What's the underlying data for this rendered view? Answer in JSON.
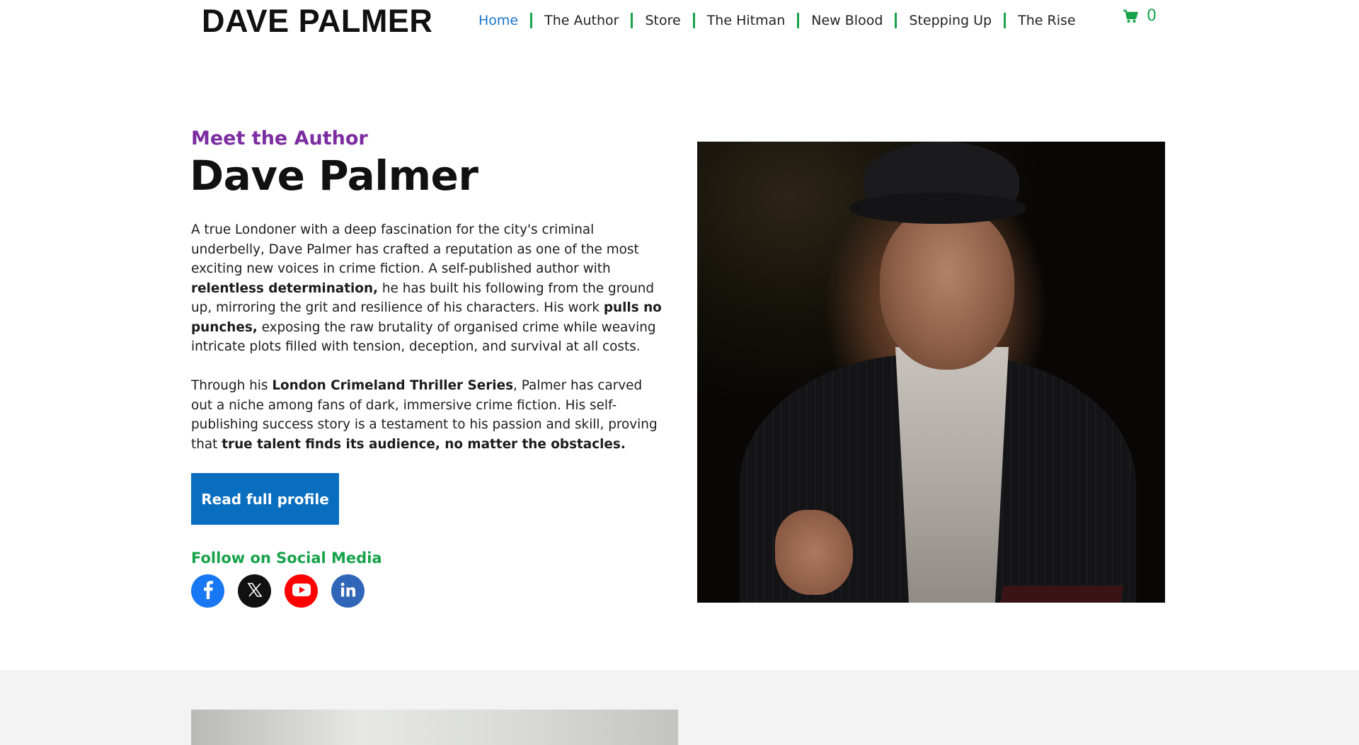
{
  "header": {
    "logo_text": "DAVE PALMER",
    "nav": [
      {
        "label": "Home",
        "active": true
      },
      {
        "label": "The Author",
        "active": false
      },
      {
        "label": "Store",
        "active": false
      },
      {
        "label": "The Hitman",
        "active": false
      },
      {
        "label": "New Blood",
        "active": false
      },
      {
        "label": "Stepping Up",
        "active": false
      },
      {
        "label": "The Rise",
        "active": false
      }
    ],
    "cart": {
      "icon": "cart-icon",
      "count": "0"
    }
  },
  "hero": {
    "kicker": "Meet the Author",
    "title": "Dave Palmer",
    "paragraph1": [
      {
        "text": "A true Londoner with a deep fascination for the city's criminal underbelly, Dave Palmer has crafted a reputation as one of the most exciting new voices in crime fiction. A self-published author with ",
        "bold": false
      },
      {
        "text": "relentless determination,",
        "bold": true
      },
      {
        "text": " he has built his following from the ground up, mirroring the grit and resilience of his characters. His work ",
        "bold": false
      },
      {
        "text": "pulls no punches,",
        "bold": true
      },
      {
        "text": " exposing the raw brutality of organised crime while weaving intricate plots filled with tension, deception, and survival at all costs.",
        "bold": false
      }
    ],
    "paragraph2": [
      {
        "text": "Through his ",
        "bold": false
      },
      {
        "text": "London Crimeland Thriller Series",
        "bold": true
      },
      {
        "text": ", Palmer has carved out a niche among fans of dark, immersive crime fiction. His self-publishing success story is a testament to his passion and skill, proving that ",
        "bold": false
      },
      {
        "text": "true talent finds its audience, no matter the obstacles.",
        "bold": true
      }
    ],
    "cta_label": "Read full profile",
    "social_title": "Follow on Social Media",
    "social": [
      {
        "name": "facebook-icon",
        "color": "#1877f2"
      },
      {
        "name": "x-icon",
        "color": "#111111"
      },
      {
        "name": "youtube-icon",
        "color": "#ff0000"
      },
      {
        "name": "linkedin-icon",
        "color": "#2f66b8"
      }
    ]
  },
  "colors": {
    "accent_blue": "#0a6ec0",
    "kicker_purple": "#7b2da1",
    "accent_green": "#17a24a",
    "lower_band": "#f3f3f3"
  }
}
